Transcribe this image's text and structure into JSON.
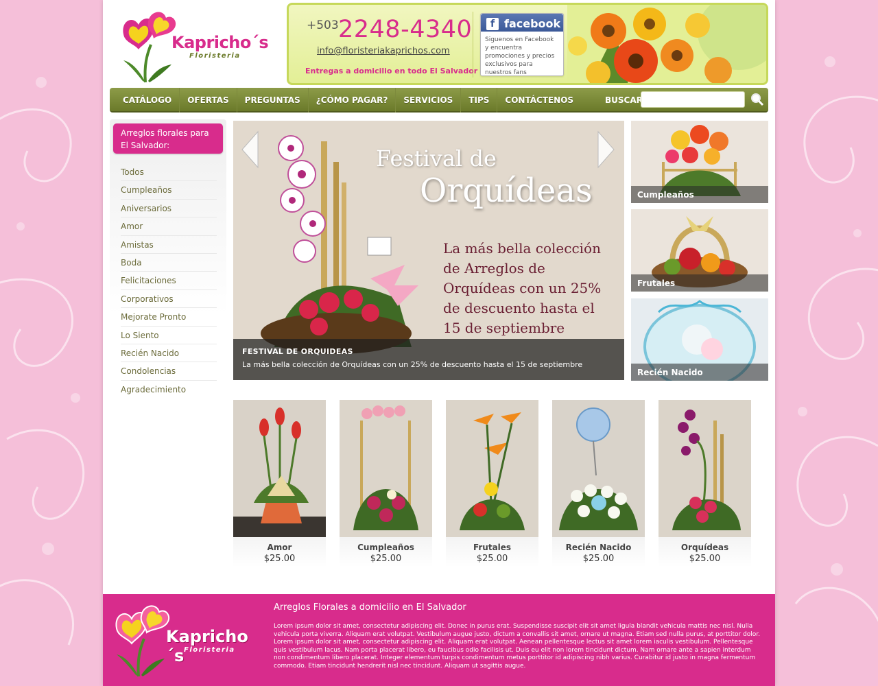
{
  "colors": {
    "pink": "#d82c8c",
    "olive": "#6b7a2a",
    "bg": "#f5bfd9"
  },
  "brand": {
    "name": "Kapricho´s",
    "subtitle": "Floristeria"
  },
  "contact": {
    "phone_prefix": "+503",
    "phone_number": "2248-4340",
    "email": "info@floristeriakaprichos.com",
    "delivery": "Entregas a domicilio en todo El Salvador"
  },
  "facebook": {
    "label": "facebook",
    "icon": "f",
    "text": "Siguenos en Facebook y encuentra promociones y precios exclusivos para nuestros fans"
  },
  "nav": {
    "items": [
      "CATÁLOGO",
      "OFERTAS",
      "PREGUNTAS",
      "¿CÓMO PAGAR?",
      "SERVICIOS",
      "TIPS",
      "CONTÁCTENOS"
    ],
    "search_label": "BUSCAR"
  },
  "sidebar": {
    "heading": "Arreglos florales para El Salvador:",
    "items": [
      "Todos",
      "Cumpleaños",
      "Aniversarios",
      "Amor",
      "Amistas",
      "Boda",
      "Felicitaciones",
      "Corporativos",
      "Mejorate Pronto",
      "Lo Siento",
      "Recién Nacido",
      "Condolencias",
      "Agradecimiento"
    ]
  },
  "slider": {
    "title_line1": "Festival de",
    "title_line2": "Orquídeas",
    "body": "La más bella colección de Arreglos de Orquídeas con un 25% de descuento hasta el 15 de septiembre",
    "caption_title": "FESTIVAL DE ORQUIDEAS",
    "caption_text": "La más bella colección de Orquídeas con un 25% de descuento hasta el 15 de septiembre"
  },
  "categories": [
    "Cumpleaños",
    "Frutales",
    "Recién Nacido"
  ],
  "products": [
    {
      "name": "Amor",
      "price": "$25.00"
    },
    {
      "name": "Cumpleaños",
      "price": "$25.00"
    },
    {
      "name": "Frutales",
      "price": "$25.00"
    },
    {
      "name": "Recién Nacido",
      "price": "$25.00"
    },
    {
      "name": "Orquídeas",
      "price": "$25.00"
    }
  ],
  "footer": {
    "title": "Arreglos Florales a domicilio en El Salvador",
    "text": "Lorem ipsum dolor sit amet, consectetur adipiscing elit. Donec in purus erat. Suspendisse suscipit elit sit amet ligula blandit vehicula mattis nec nisl. Nulla vehicula porta viverra. Aliquam erat volutpat. Vestibulum augue justo, dictum a convallis sit amet, ornare ut magna. Etiam sed nulla purus, at porttitor dolor. Lorem ipsum dolor sit amet, consectetur adipiscing elit. Aliquam erat volutpat. Aenean pellentesque lectus sit amet lorem iaculis vestibulum. Pellentesque quis vestibulum lacus. Nam porta placerat libero, eu faucibus odio facilisis ut. Duis eu elit non lorem tincidunt dictum. Nam ornare ante a sapien interdum non condimentum libero placerat. Integer elementum turpis condimentum metus porttitor id adipiscing nibh varius. Curabitur id justo in magna fermentum commodo. Etiam tincidunt hendrerit nisl nec tincidunt. Aliquam ut sagittis augue."
  }
}
